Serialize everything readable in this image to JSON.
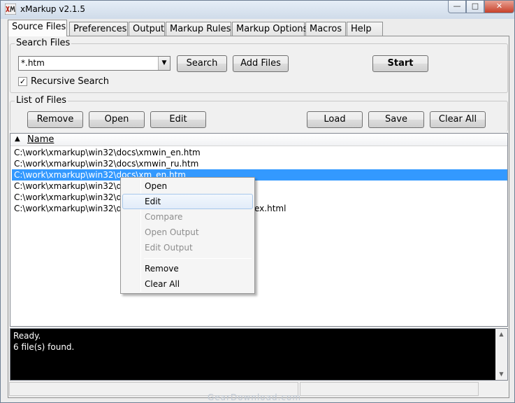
{
  "window": {
    "title": "xMarkup v2.1.5",
    "controls": {
      "minimize": "—",
      "maximize": "□",
      "close": "✕"
    }
  },
  "tabs": [
    {
      "label": "Source Files",
      "active": true
    },
    {
      "label": "Preferences"
    },
    {
      "label": "Output"
    },
    {
      "label": "Markup Rules"
    },
    {
      "label": "Markup Options"
    },
    {
      "label": "Macros"
    },
    {
      "label": "Help"
    }
  ],
  "search_files": {
    "group_label": "Search Files",
    "mask_value": "*.htm",
    "search_button": "Search",
    "add_files_button": "Add Files",
    "start_button": "Start",
    "recursive_label": "Recursive Search",
    "recursive_checked": true
  },
  "list_of_files": {
    "group_label": "List of Files",
    "buttons": {
      "remove": "Remove",
      "open": "Open",
      "edit": "Edit",
      "load": "Load",
      "save": "Save",
      "clear_all": "Clear All"
    },
    "column_name": "Name",
    "rows": [
      "C:\\work\\xmarkup\\win32\\docs\\xmwin_en.htm",
      "C:\\work\\xmarkup\\win32\\docs\\xmwin_ru.htm",
      "C:\\work\\xmarkup\\win32\\docs\\xm_en.htm",
      "C:\\work\\xmarkup\\win32\\doc",
      "C:\\work\\xmarkup\\win32\\doc",
      "C:\\work\\xmarkup\\win32\\do"
    ],
    "row6_suffix": "ex.html",
    "selected_index": 2
  },
  "context_menu": {
    "open": "Open",
    "edit": "Edit",
    "compare": "Compare",
    "open_output": "Open Output",
    "edit_output": "Edit Output",
    "remove": "Remove",
    "clear_all": "Clear All"
  },
  "log": {
    "line1": "Ready.",
    "line2": "6 file(s) found."
  },
  "watermark": "GearDownload.com",
  "colors": {
    "selection": "#3399ff",
    "log_background": "#000000",
    "close_button": "#c7412a"
  }
}
